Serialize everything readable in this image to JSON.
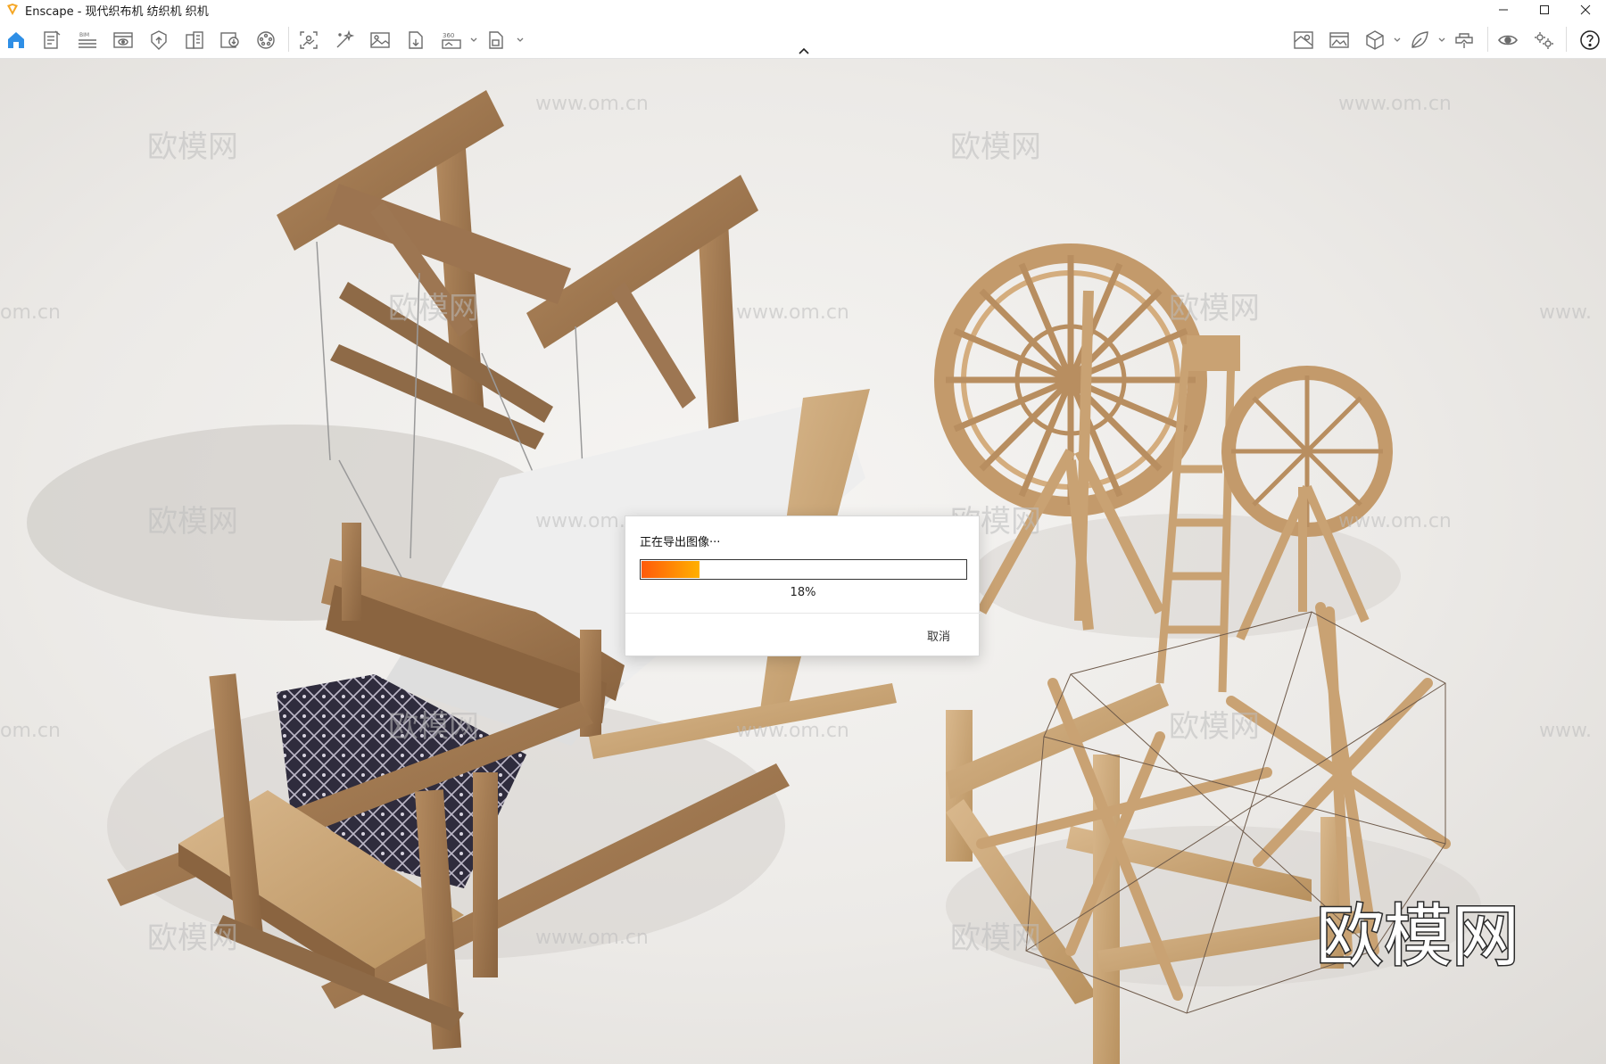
{
  "window": {
    "title": "Enscape - 现代织布机 纺织机 织机",
    "minimize_icon": "minimize-icon",
    "maximize_icon": "maximize-icon",
    "close_icon": "close-icon"
  },
  "toolbar": {
    "left_icons": [
      "home-icon",
      "document-icon",
      "bim-icon",
      "view-icon",
      "upload-icon",
      "building-icon",
      "cloud-icon",
      "palette-icon",
      "capture-icon",
      "magic-wand-icon",
      "image-icon",
      "export-document-icon",
      "panorama-360-icon",
      "batch-export-icon"
    ],
    "right_icons": [
      "minimap-icon",
      "gallery-icon",
      "cube-icon",
      "leaf-icon",
      "vr-headset-icon",
      "eye-icon",
      "settings-icon",
      "help-icon"
    ],
    "bim_label": "BIM",
    "pano_label": "360"
  },
  "viewport": {
    "watermarks": [
      "欧模网",
      "www.om.cn",
      "om.cn",
      "www."
    ],
    "brand_logo": "欧模网"
  },
  "dialog": {
    "title": "正在导出图像···",
    "progress": 0.18,
    "progress_label": "18%",
    "cancel_label": "取消",
    "accent_from": "#ff5a0a",
    "accent_to": "#ffb000"
  }
}
